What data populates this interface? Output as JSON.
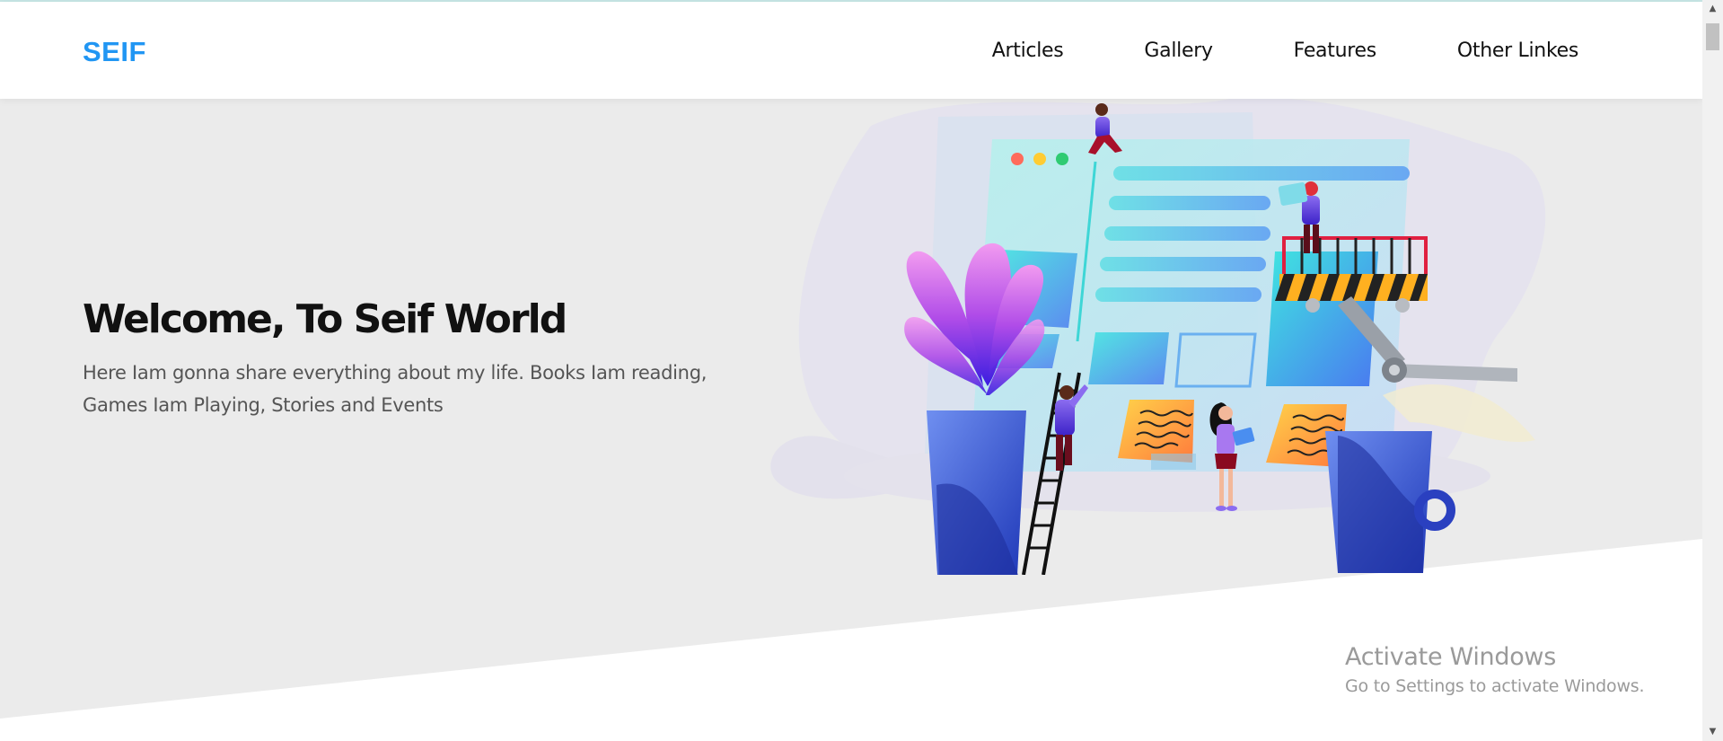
{
  "header": {
    "logo": "SEIF",
    "nav": [
      {
        "label": "Articles"
      },
      {
        "label": "Gallery"
      },
      {
        "label": "Features"
      },
      {
        "label": "Other Linkes"
      }
    ]
  },
  "hero": {
    "title": "Welcome, To Seif World",
    "text": "Here Iam gonna share everything about my life. Books Iam reading, Games Iam Playing, Stories and Events"
  },
  "watermark": {
    "title": "Activate Windows",
    "subtitle": "Go to Settings to activate Windows."
  },
  "colors": {
    "brand": "#2196f3",
    "hero_bg": "#ebebeb",
    "text_dark": "#111111",
    "text_muted": "#555555"
  }
}
